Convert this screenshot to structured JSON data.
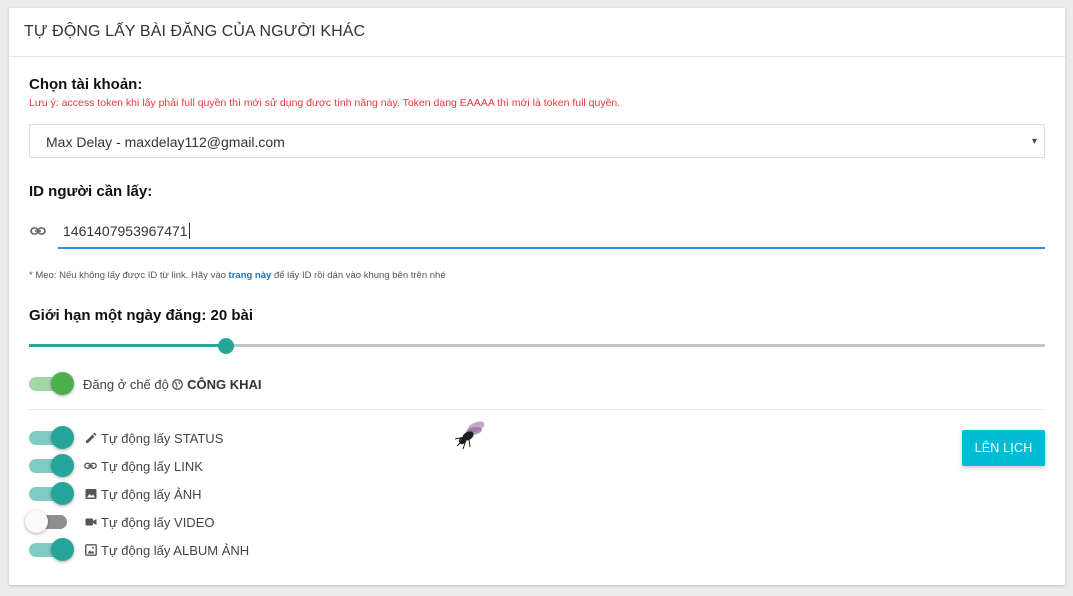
{
  "header": {
    "title": "TỰ ĐỘNG LẤY BÀI ĐĂNG CỦA NGƯỜI KHÁC"
  },
  "account": {
    "label": "Chọn tài khoản:",
    "note": "Lưu ý: access token khi lấy phải full quyền thì mới sử dụng được tính năng này. Token dạng EAAAA thì mới là token full quyền.",
    "selected": "Max Delay - maxdelay112@gmail.com",
    "arrow": "▾"
  },
  "target": {
    "label": "ID người cần lấy:",
    "value": "1461407953967471",
    "tip_before": "* Mẹo: Nếu không lấy được ID từ link. Hãy vào ",
    "tip_link": "trang này",
    "tip_after": " để lấy ID rồi dán vào khung bên trên nhé"
  },
  "limit": {
    "label": "Giới hạn một ngày đăng: 20 bài",
    "fraction": 0.194
  },
  "publish": {
    "enabled": true,
    "text_before": "Đăng ở chế độ",
    "mode": "CÔNG KHAI",
    "icon": "globe-icon"
  },
  "options": [
    {
      "label": "Tự động lấy STATUS",
      "enabled": true,
      "icon": "pencil-icon"
    },
    {
      "label": "Tự động lấy LINK",
      "enabled": true,
      "icon": "link-icon"
    },
    {
      "label": "Tự động lấy ẢNH",
      "enabled": true,
      "icon": "image-icon"
    },
    {
      "label": "Tự động lấy VIDEO",
      "enabled": false,
      "icon": "video-icon"
    },
    {
      "label": "Tự động lấy ALBUM ẢNH",
      "enabled": true,
      "icon": "album-icon"
    }
  ],
  "schedule_button": "LÊN LỊCH",
  "colors": {
    "accent": "#26a69a",
    "toggle_track_on": "#80cbc4",
    "publish_toggle_knob": "#4caf50",
    "publish_toggle_track": "#a5d6a7",
    "button": "#00bcd4",
    "note_red": "#e53935",
    "input_underline": "#2f8fe0"
  }
}
